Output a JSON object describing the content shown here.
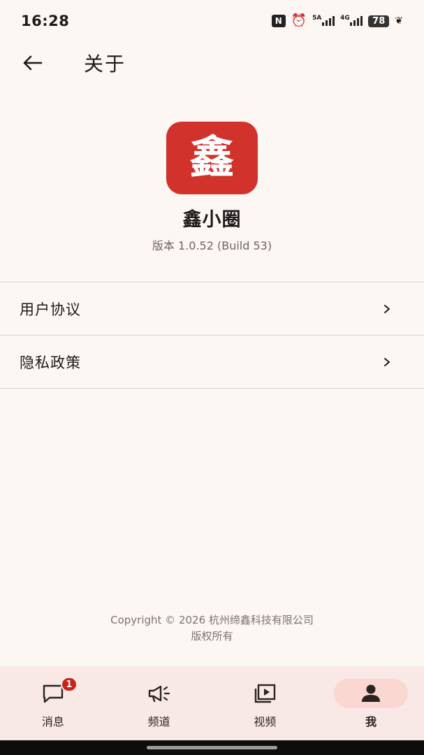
{
  "status_bar": {
    "time": "16:28",
    "net1": "5A",
    "net2": "4G",
    "battery": "78",
    "icons": [
      "nfc-icon",
      "alarm-icon",
      "signal-5a-icon",
      "signal-4g-icon",
      "battery-icon",
      "leaf-icon"
    ]
  },
  "header": {
    "back_icon": "arrow-left-icon",
    "title": "关于"
  },
  "app": {
    "logo_char": "鑫",
    "name": "鑫小圈",
    "version": "版本 1.0.52 (Build 53)",
    "logo_color": "#d2322c"
  },
  "list": [
    {
      "label": "用户协议"
    },
    {
      "label": "隐私政策"
    }
  ],
  "footer": {
    "copyright": "Copyright © 2026 杭州缔鑫科技有限公司",
    "rights": "版权所有"
  },
  "bottom_nav": {
    "items": [
      {
        "label": "消息",
        "icon": "chat-icon",
        "badge": "1"
      },
      {
        "label": "频道",
        "icon": "megaphone-icon"
      },
      {
        "label": "视频",
        "icon": "video-play-icon"
      },
      {
        "label": "我",
        "icon": "person-icon",
        "active": true
      }
    ]
  },
  "colors": {
    "background": "#fdf7f4",
    "nav_background": "#f8e9e6",
    "active_pill": "#fad7d0",
    "badge": "#c8241c"
  }
}
